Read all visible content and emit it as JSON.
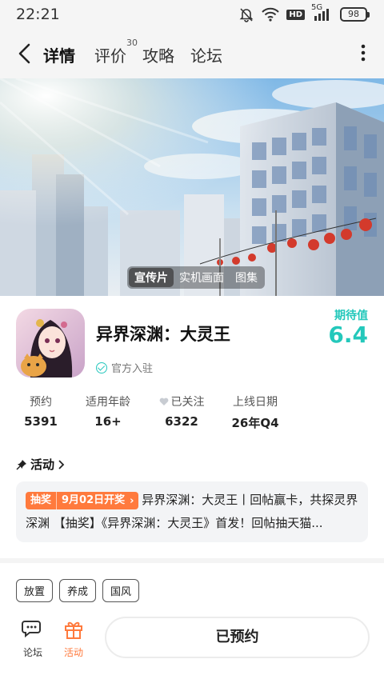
{
  "status_bar": {
    "time": "22:21",
    "network": "5G",
    "hd": "HD",
    "battery": "98"
  },
  "nav": {
    "tabs": [
      {
        "label": "详情",
        "active": true
      },
      {
        "label": "评价",
        "badge": "30"
      },
      {
        "label": "攻略"
      },
      {
        "label": "论坛"
      }
    ]
  },
  "media": {
    "tabs": [
      "宣传片",
      "实机画面",
      "图集"
    ],
    "active": "宣传片"
  },
  "game": {
    "title": "异界深渊：大灵王",
    "official": "官方入驻",
    "expect_label": "期待值",
    "expect_value": "6.4"
  },
  "stats": [
    {
      "label": "预约",
      "value": "5391"
    },
    {
      "label": "适用年龄",
      "value": "16+"
    },
    {
      "label": "已关注",
      "value": "6322"
    },
    {
      "label": "上线日期",
      "value": "26年Q4"
    }
  ],
  "activity": {
    "heading": "活动",
    "badge_type": "抽奖",
    "badge_date": "9月02日开奖",
    "text": "异界深渊：大灵王丨回帖赢卡，共探灵界深渊 【抽奖】《异界深渊：大灵王》首发！回帖抽天猫..."
  },
  "tags": [
    "放置",
    "养成",
    "国风"
  ],
  "bottom_bar": {
    "forum_label": "论坛",
    "activity_label": "活动",
    "reserve_label": "已预约"
  },
  "colors": {
    "accent": "#2ed3c8",
    "orange": "#ff7a3d"
  }
}
